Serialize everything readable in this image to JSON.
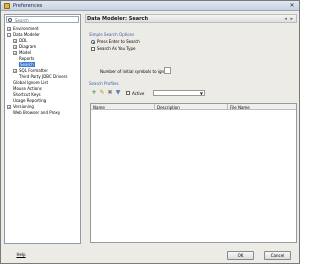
{
  "window": {
    "title": "Preferences",
    "close_glyph": "✕"
  },
  "sidebar": {
    "search_placeholder": "Search",
    "items": [
      {
        "label": "Environment",
        "expander": "+",
        "depth": 0
      },
      {
        "label": "Data Modeler",
        "expander": "−",
        "depth": 0
      },
      {
        "label": "DDL",
        "expander": "+",
        "depth": 1
      },
      {
        "label": "Diagram",
        "expander": "+",
        "depth": 1
      },
      {
        "label": "Model",
        "expander": "+",
        "depth": 1
      },
      {
        "label": "Reports",
        "expander": "",
        "depth": 1
      },
      {
        "label": "Search",
        "expander": "",
        "depth": 1,
        "selected": true
      },
      {
        "label": "SQL Formatter",
        "expander": "+",
        "depth": 1
      },
      {
        "label": "Third Party JDBC Drivers",
        "expander": "",
        "depth": 1
      },
      {
        "label": "Global Ignore List",
        "expander": "",
        "depth": 0
      },
      {
        "label": "Mouse Actions",
        "expander": "",
        "depth": 0
      },
      {
        "label": "Shortcut Keys",
        "expander": "",
        "depth": 0
      },
      {
        "label": "Usage Reporting",
        "expander": "",
        "depth": 0
      },
      {
        "label": "Versioning",
        "expander": "+",
        "depth": 0
      },
      {
        "label": "Web Browser and Proxy",
        "expander": "",
        "depth": 0
      }
    ]
  },
  "main": {
    "header_title": "Data Modeler: Search",
    "header_nav": "◂ ▸",
    "simple_options_title": "Simple Search Options",
    "option_press_enter": "Press Enter to Search",
    "option_search_as_type": "Search As You Type",
    "number_label": "Number of initial symbols to ignore",
    "profiles_title": "Search Profiles",
    "active_label": "Active",
    "table_headers": {
      "name": "Name",
      "description": "Description",
      "file_name": "File Name"
    }
  },
  "footer": {
    "help": "Help",
    "ok": "OK",
    "cancel": "Cancel"
  }
}
